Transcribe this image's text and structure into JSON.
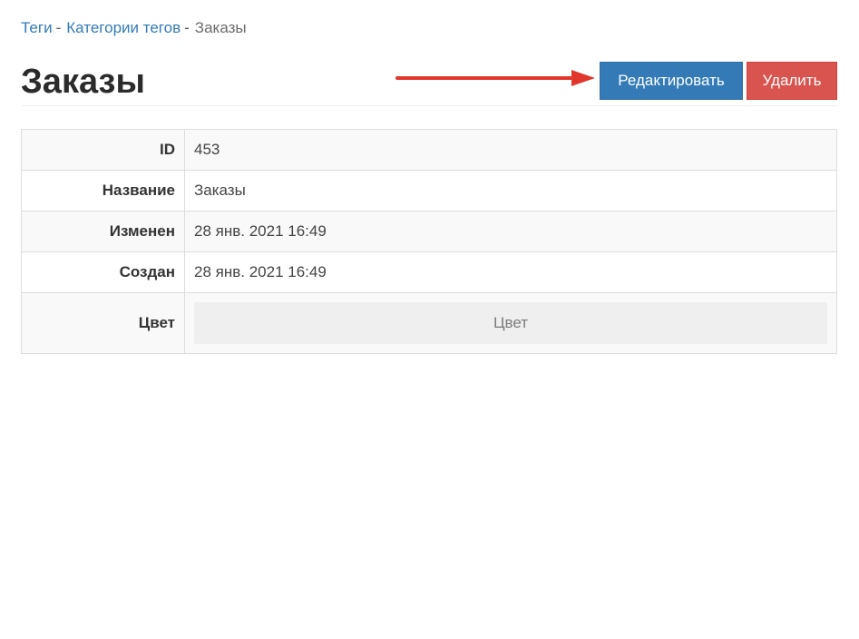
{
  "breadcrumb": {
    "items": [
      {
        "label": "Теги",
        "separator": "-"
      },
      {
        "label": "Категории тегов",
        "separator": "-"
      }
    ],
    "current": "Заказы"
  },
  "page": {
    "title": "Заказы"
  },
  "actions": {
    "edit_label": "Редактировать",
    "delete_label": "Удалить"
  },
  "details": {
    "rows": [
      {
        "label": "ID",
        "value": "453"
      },
      {
        "label": "Название",
        "value": "Заказы"
      },
      {
        "label": "Изменен",
        "value": "28 янв. 2021 16:49"
      },
      {
        "label": "Создан",
        "value": "28 янв. 2021 16:49"
      },
      {
        "label": "Цвет",
        "value": "Цвет"
      }
    ]
  },
  "colors": {
    "link": "#337ab7",
    "primary": "#337ab7",
    "danger": "#d9534f",
    "annotation_arrow": "#e0362c"
  },
  "annotation": {
    "icon": "right-arrow-icon"
  }
}
